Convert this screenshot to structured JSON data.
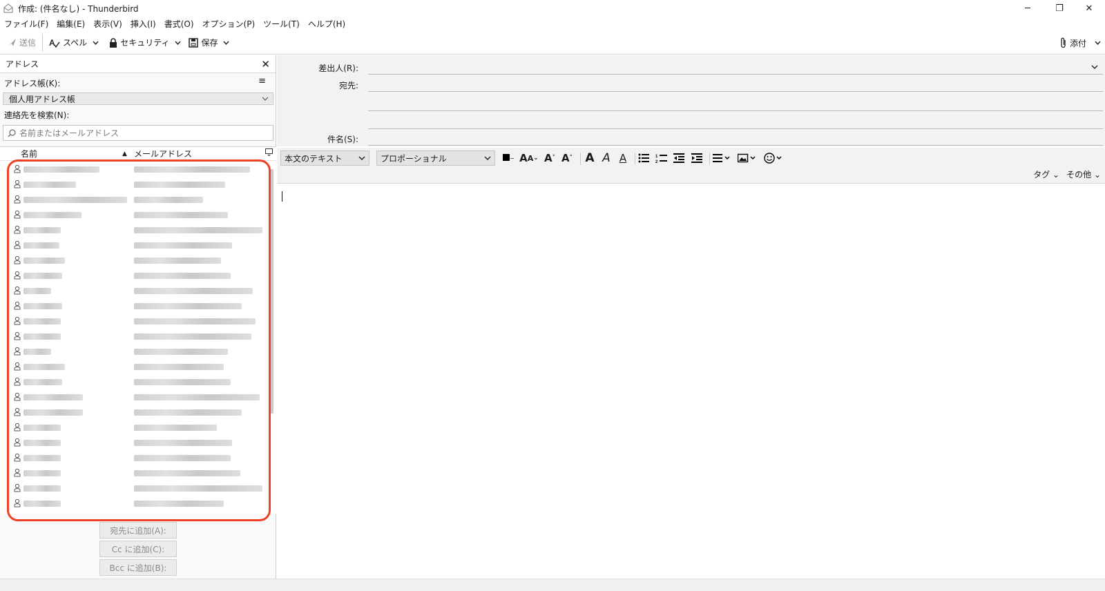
{
  "window": {
    "title": "作成: (件名なし) - Thunderbird",
    "minimize": "─",
    "restore": "❐",
    "close": "✕"
  },
  "menu": [
    "ファイル(F)",
    "編集(E)",
    "表示(V)",
    "挿入(I)",
    "書式(O)",
    "オプション(P)",
    "ツール(T)",
    "ヘルプ(H)"
  ],
  "toolbar": {
    "send": "送信",
    "spell": "スペル",
    "security": "セキュリティ",
    "save": "保存",
    "attach": "添付"
  },
  "sidebar": {
    "title": "アドレス",
    "addressbook_label": "アドレス帳(K):",
    "addressbook_value": "個人用アドレス帳",
    "search_label": "連絡先を検索(N):",
    "search_placeholder": "名前またはメールアドレス",
    "col_name": "名前",
    "col_email": "メールアドレス",
    "add_to": "宛先に追加(A):",
    "add_cc": "Cc に追加(C):",
    "add_bcc": "Bcc に追加(B):"
  },
  "compose": {
    "from_label": "差出人(R):",
    "to_label": "宛先:",
    "subject_label": "件名(S):",
    "paragraph_format": "本文のテキスト",
    "font": "プロポーショナル",
    "tags": "タグ",
    "other": "その他"
  }
}
